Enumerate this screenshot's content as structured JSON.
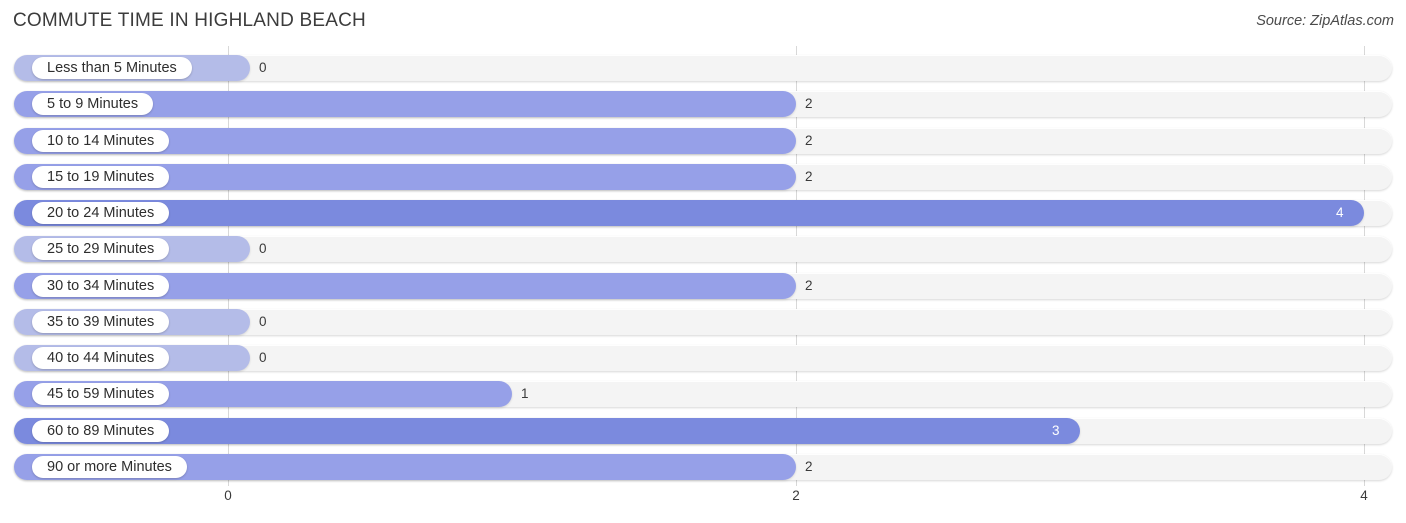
{
  "header": {
    "title": "COMMUTE TIME IN HIGHLAND BEACH",
    "source": "Source: ZipAtlas.com"
  },
  "colors": {
    "bar_primary": "#7b8ade",
    "bar_secondary": "#96a0e8",
    "bar_zero": "#b4bce8",
    "track": "#f4f4f4",
    "gridline": "#d8d8d8",
    "title_text": "#3c3c3c"
  },
  "chart_data": {
    "type": "bar",
    "orientation": "horizontal",
    "title": "COMMUTE TIME IN HIGHLAND BEACH",
    "xlabel": "",
    "ylabel": "",
    "xlim": [
      0,
      4
    ],
    "xticks": [
      "0",
      "2",
      "4"
    ],
    "xtick_values": [
      0,
      2,
      4
    ],
    "grid": true,
    "legend": null,
    "categories": [
      "Less than 5 Minutes",
      "5 to 9 Minutes",
      "10 to 14 Minutes",
      "15 to 19 Minutes",
      "20 to 24 Minutes",
      "25 to 29 Minutes",
      "30 to 34 Minutes",
      "35 to 39 Minutes",
      "40 to 44 Minutes",
      "45 to 59 Minutes",
      "60 to 89 Minutes",
      "90 or more Minutes"
    ],
    "values": [
      0,
      2,
      2,
      2,
      4,
      0,
      2,
      0,
      0,
      1,
      3,
      2
    ],
    "value_labels": [
      "0",
      "2",
      "2",
      "2",
      "4",
      "0",
      "2",
      "0",
      "0",
      "1",
      "3",
      "2"
    ]
  },
  "rows": [
    {
      "label": "Less than 5 Minutes",
      "value": 0,
      "value_label": "0"
    },
    {
      "label": "5 to 9 Minutes",
      "value": 2,
      "value_label": "2"
    },
    {
      "label": "10 to 14 Minutes",
      "value": 2,
      "value_label": "2"
    },
    {
      "label": "15 to 19 Minutes",
      "value": 2,
      "value_label": "2"
    },
    {
      "label": "20 to 24 Minutes",
      "value": 4,
      "value_label": "4"
    },
    {
      "label": "25 to 29 Minutes",
      "value": 0,
      "value_label": "0"
    },
    {
      "label": "30 to 34 Minutes",
      "value": 2,
      "value_label": "2"
    },
    {
      "label": "35 to 39 Minutes",
      "value": 0,
      "value_label": "0"
    },
    {
      "label": "40 to 44 Minutes",
      "value": 0,
      "value_label": "0"
    },
    {
      "label": "45 to 59 Minutes",
      "value": 1,
      "value_label": "1"
    },
    {
      "label": "60 to 89 Minutes",
      "value": 3,
      "value_label": "3"
    },
    {
      "label": "90 or more Minutes",
      "value": 2,
      "value_label": "2"
    }
  ],
  "axis": {
    "ticks": [
      "0",
      "2",
      "4"
    ]
  }
}
